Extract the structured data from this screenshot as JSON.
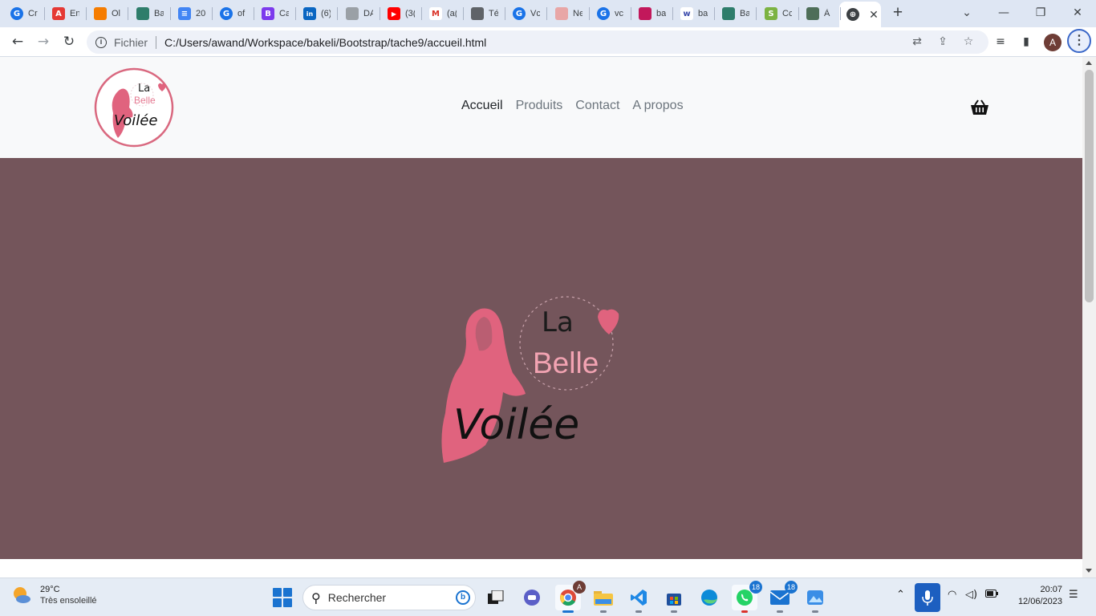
{
  "browser": {
    "tabs": [
      {
        "title": "Cr",
        "icon": "google-icon",
        "color": "#1a73e8"
      },
      {
        "title": "En",
        "icon": "a-app-icon",
        "color": "#e53935"
      },
      {
        "title": "Ol",
        "icon": "cloud-icon",
        "color": "#f57c00"
      },
      {
        "title": "Ba",
        "icon": "figure-icon",
        "color": "#2e7d6b"
      },
      {
        "title": "20",
        "icon": "doc-icon",
        "color": "#4285f4"
      },
      {
        "title": "of",
        "icon": "google-icon",
        "color": "#1a73e8"
      },
      {
        "title": "Ca",
        "icon": "b-app-icon",
        "color": "#7c3aed"
      },
      {
        "title": "(6)",
        "icon": "linkedin-icon",
        "color": "#0a66c2"
      },
      {
        "title": "DA",
        "icon": "drop-icon",
        "color": "#9aa0a6"
      },
      {
        "title": "(3(",
        "icon": "youtube-icon",
        "color": "#ff0000"
      },
      {
        "title": "(a(",
        "icon": "gmail-icon",
        "color": "#d93025"
      },
      {
        "title": "Té",
        "icon": "graduation-icon",
        "color": "#5f6368"
      },
      {
        "title": "Vc",
        "icon": "google-icon",
        "color": "#1a73e8"
      },
      {
        "title": "Ne",
        "icon": "notion-icon",
        "color": "#e8a6a6"
      },
      {
        "title": "vc",
        "icon": "google-icon",
        "color": "#1a73e8"
      },
      {
        "title": "ba",
        "icon": "tag-icon",
        "color": "#c2185b"
      },
      {
        "title": "ba",
        "icon": "wix-icon",
        "color": "#3949ab"
      },
      {
        "title": "Ba",
        "icon": "figure-icon",
        "color": "#2e7d6b"
      },
      {
        "title": "Cc",
        "icon": "shopify-icon",
        "color": "#7cb342"
      },
      {
        "title": "À",
        "icon": "tree-icon",
        "color": "#4e6e58"
      }
    ],
    "active_tab_icon": "globe-icon",
    "new_tab": "+",
    "window_controls": {
      "minimize": "—",
      "restore": "❐",
      "close": "✕",
      "dropdown": "⌄"
    },
    "nav": {
      "back": "←",
      "forward": "→",
      "reload": "↻"
    },
    "address": {
      "scheme": "Fichier",
      "url": "C:/Users/awand/Workspace/bakeli/Bootstrap/tache9/accueil.html"
    },
    "profile_initial": "A"
  },
  "site": {
    "logo": {
      "la": "La",
      "belle": "Belle",
      "voilee": "Voilée"
    },
    "nav": [
      {
        "label": "Accueil",
        "active": true
      },
      {
        "label": "Produits",
        "active": false
      },
      {
        "label": "Contact",
        "active": false
      },
      {
        "label": "A propos",
        "active": false
      }
    ],
    "cart_icon": "basket-icon",
    "hero_color": "#74555b",
    "brand_pink": "#e0637e"
  },
  "taskbar": {
    "weather": {
      "temp": "29°C",
      "desc": "Très ensoleillé"
    },
    "search_placeholder": "Rechercher",
    "apps": [
      {
        "name": "task-view",
        "badge": ""
      },
      {
        "name": "teams",
        "badge": ""
      },
      {
        "name": "chrome",
        "badge": "A"
      },
      {
        "name": "file-explorer",
        "badge": ""
      },
      {
        "name": "vscode",
        "badge": ""
      },
      {
        "name": "store",
        "badge": ""
      },
      {
        "name": "edge",
        "badge": ""
      },
      {
        "name": "whatsapp",
        "badge": "18"
      },
      {
        "name": "mail",
        "badge": "18"
      },
      {
        "name": "photos",
        "badge": ""
      }
    ],
    "clock": {
      "time": "20:07",
      "date": "12/06/2023"
    }
  }
}
